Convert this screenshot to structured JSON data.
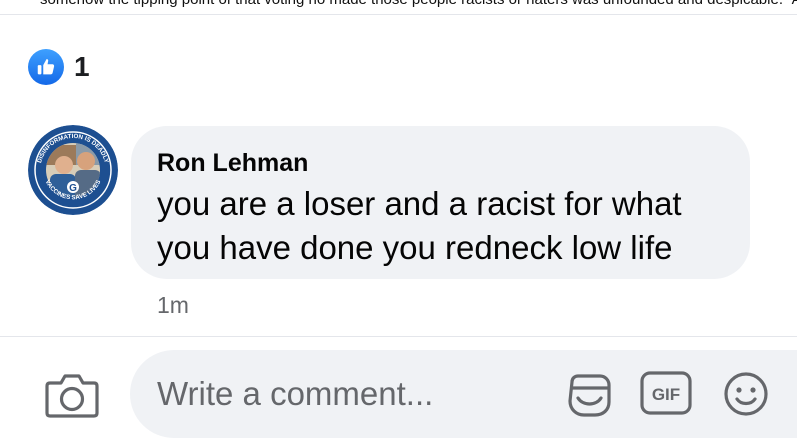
{
  "post": {
    "truncated_text": "somehow the tipping point of that voting no made those people racists or haters was unfounded and despicable.\" And the"
  },
  "reactions": {
    "icon": "thumbs-up-icon",
    "count": "1",
    "color": "#1877f2"
  },
  "comment": {
    "author": "Ron Lehman",
    "text": "you are a loser and a racist for what you have done you redneck low life",
    "timestamp": "1m",
    "avatar": {
      "ring_text": "DISINFORMATION IS DEADLY",
      "bottom_text": "VACCINES SAVE LIVES",
      "ring_color": "#1d4f91"
    }
  },
  "composer": {
    "placeholder": "Write a comment...",
    "value": "",
    "gif_label": "GIF",
    "icons": [
      "camera-icon",
      "sticker-icon",
      "gif-icon",
      "emoji-icon"
    ]
  }
}
